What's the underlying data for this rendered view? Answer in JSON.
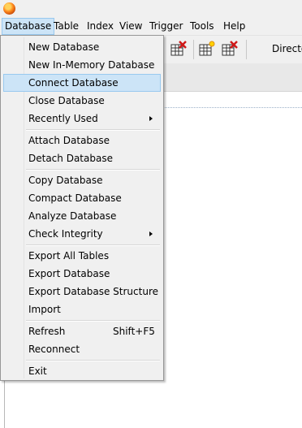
{
  "menubar": {
    "items": [
      "Database",
      "Table",
      "Index",
      "View",
      "Trigger",
      "Tools",
      "Help"
    ]
  },
  "toolbar": {
    "directory_label": "Directo"
  },
  "database_menu": {
    "items": [
      {
        "label": "New Database"
      },
      {
        "label": "New In-Memory Database"
      },
      {
        "label": "Connect Database",
        "highlighted": true
      },
      {
        "label": "Close Database"
      },
      {
        "label": "Recently Used",
        "submenu": true
      },
      {
        "label": "Attach Database"
      },
      {
        "label": "Detach Database"
      },
      {
        "label": "Copy Database"
      },
      {
        "label": "Compact Database"
      },
      {
        "label": "Analyze Database"
      },
      {
        "label": "Check Integrity",
        "submenu": true
      },
      {
        "label": "Export All Tables"
      },
      {
        "label": "Export Database"
      },
      {
        "label": "Export Database Structure"
      },
      {
        "label": "Import"
      },
      {
        "label": "Refresh",
        "shortcut": "Shift+F5"
      },
      {
        "label": "Reconnect"
      },
      {
        "label": "Exit"
      }
    ]
  },
  "colors": {
    "highlight_bg": "#cce4f7",
    "highlight_border": "#99c9ef",
    "menu_bg": "#f0f0f0"
  }
}
